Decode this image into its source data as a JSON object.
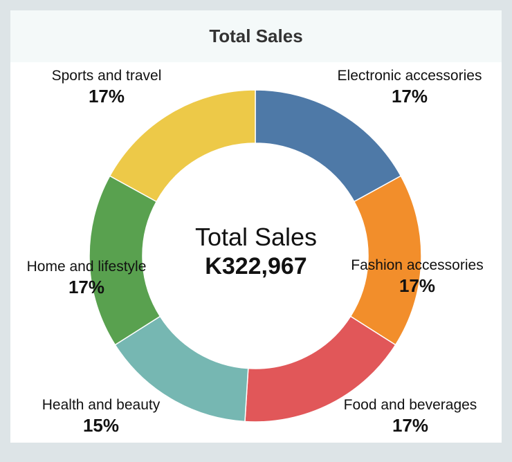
{
  "header": {
    "title": "Total Sales"
  },
  "center": {
    "title": "Total Sales",
    "value": "K322,967"
  },
  "chart_data": {
    "type": "pie",
    "title": "Total Sales",
    "total": "K322,967",
    "categories": [
      "Electronic accessories",
      "Fashion accessories",
      "Food and beverages",
      "Health and beauty",
      "Home and lifestyle",
      "Sports and travel"
    ],
    "values": [
      17,
      17,
      17,
      15,
      17,
      17
    ],
    "value_labels": [
      "17%",
      "17%",
      "17%",
      "15%",
      "17%",
      "17%"
    ],
    "colors": [
      "#4e79a7",
      "#f28e2b",
      "#e15759",
      "#76b7b2",
      "#59a14f",
      "#edc948"
    ]
  }
}
